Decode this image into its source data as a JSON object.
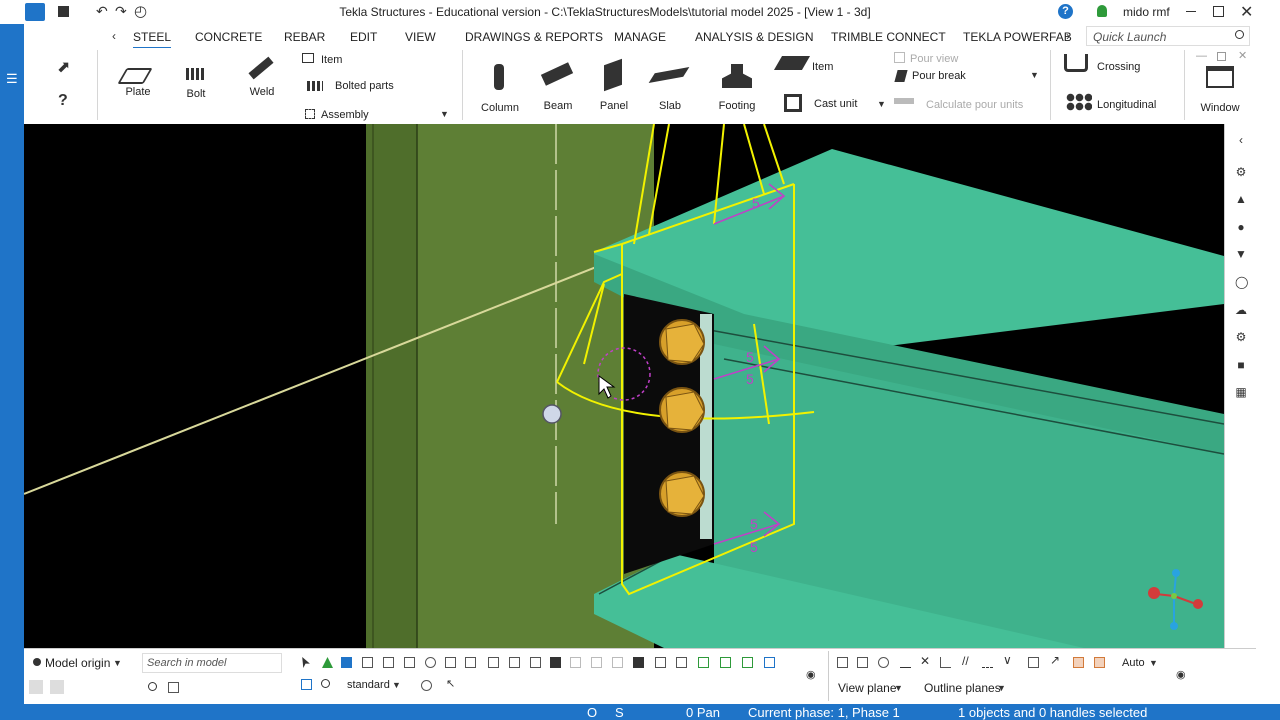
{
  "window": {
    "title": "Tekla Structures - Educational version - C:\\TeklaStructuresModels\\tutorial model 2025  - [View 1 - 3d]",
    "user": "mido rmf"
  },
  "menu_tabs": [
    {
      "label": "STEEL",
      "active": true
    },
    {
      "label": "CONCRETE",
      "active": false
    },
    {
      "label": "REBAR",
      "active": false
    },
    {
      "label": "EDIT",
      "active": false
    },
    {
      "label": "VIEW",
      "active": false
    },
    {
      "label": "DRAWINGS & REPORTS",
      "active": false
    },
    {
      "label": "MANAGE",
      "active": false
    },
    {
      "label": "ANALYSIS & DESIGN",
      "active": false
    },
    {
      "label": "TRIMBLE CONNECT",
      "active": false
    },
    {
      "label": "TEKLA POWERFAB",
      "active": false
    }
  ],
  "quick_launch": "Quick Launch",
  "ribbon": {
    "plate": "Plate",
    "bolt": "Bolt",
    "weld": "Weld",
    "item": "Item",
    "bolted_parts": "Bolted parts",
    "assembly": "Assembly",
    "column": "Column",
    "beam": "Beam",
    "panel": "Panel",
    "slab": "Slab",
    "footing": "Footing",
    "item2": "Item",
    "cast_unit": "Cast unit",
    "pour_view": "Pour view",
    "pour_break": "Pour break",
    "calculate_pour_units": "Calculate pour units",
    "crossing": "Crossing",
    "longitudinal": "Longitudinal",
    "window": "Window"
  },
  "viewport": {
    "dimension_label": "5"
  },
  "bottom": {
    "model_origin": "Model origin",
    "search_placeholder": "Search in model",
    "standard": "standard",
    "auto": "Auto",
    "view_plane": "View plane",
    "outline_planes": "Outline planes"
  },
  "status": {
    "o": "O",
    "s": "S",
    "pan": "0  Pan",
    "phase": "Current phase: 1, Phase 1",
    "selection": "1 objects and 0 handles selected"
  },
  "colors": {
    "accent": "#1f74c8",
    "beam": "#45bf97",
    "column": "#5e7f35",
    "highlight": "#f2f200",
    "weld": "#c040c8",
    "bolt": "#d8a02a"
  }
}
